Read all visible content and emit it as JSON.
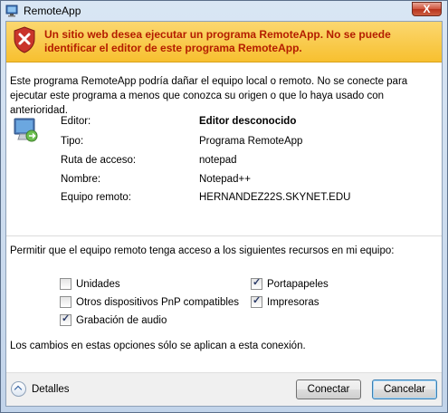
{
  "window": {
    "title": "RemoteApp",
    "close_label": "X"
  },
  "banner": {
    "message": "Un sitio web desea ejecutar un programa RemoteApp. No se puede identificar el editor de este programa RemoteApp."
  },
  "description": "Este programa RemoteApp podría dañar el equipo local o remoto. No se conecte para ejecutar este programa a menos que conozca su origen o que lo haya usado con anterioridad.",
  "info": {
    "icon": "remote-computer-icon",
    "rows": [
      {
        "label": "Editor:",
        "value": "Editor desconocido"
      },
      {
        "label": "Tipo:",
        "value": "Programa RemoteApp"
      },
      {
        "label": "Ruta de acceso:",
        "value": "notepad"
      },
      {
        "label": "Nombre:",
        "value": "Notepad++"
      },
      {
        "label": "Equipo remoto:",
        "value": "HERNANDEZ22S.SKYNET.EDU"
      }
    ]
  },
  "permissions": {
    "intro": "Permitir que el equipo remoto tenga acceso a los siguientes recursos en mi equipo:",
    "items": [
      {
        "label": "Unidades",
        "checked": false
      },
      {
        "label": "Otros dispositivos PnP compatibles",
        "checked": false
      },
      {
        "label": "Grabación de audio",
        "checked": true
      },
      {
        "label": "Portapapeles",
        "checked": true
      },
      {
        "label": "Impresoras",
        "checked": true
      }
    ],
    "note": "Los cambios en estas opciones sólo se aplican a esta conexión."
  },
  "footer": {
    "details_label": "Detalles",
    "connect_label": "Conectar",
    "cancel_label": "Cancelar"
  },
  "colors": {
    "banner_bg": "#f7c02f",
    "banner_text": "#b41d00"
  }
}
